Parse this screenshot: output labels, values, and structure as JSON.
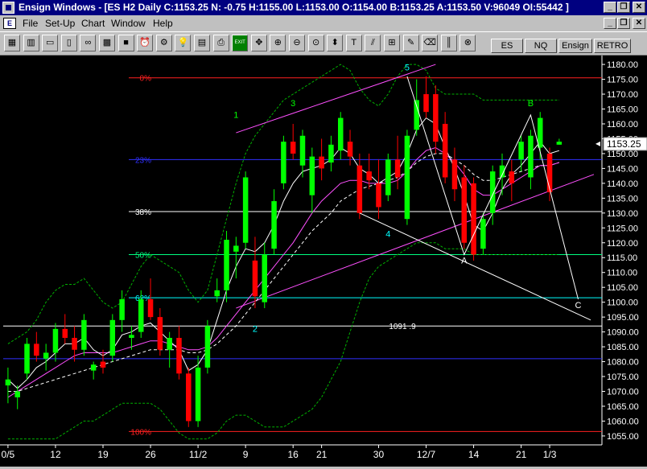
{
  "window": {
    "title": "Ensign Windows - [ES H2 Daily C:1153.25 N: -0.75 H:1155.00 L:1153.00 O:1154.00 B:1153.25 A:1153.50 V:96049 OI:55442 ]",
    "min_glyph": "_",
    "restore_glyph": "❐",
    "close_glyph": "✕"
  },
  "menu": {
    "items": [
      "File",
      "Set-Up",
      "Chart",
      "Window",
      "Help"
    ]
  },
  "toolbar": {
    "tools": [
      {
        "icon": "chart-grid-icon",
        "glyph": "▦"
      },
      {
        "icon": "chart-bars-icon",
        "glyph": "▥"
      },
      {
        "icon": "window-icon",
        "glyph": "▭"
      },
      {
        "icon": "page-icon",
        "glyph": "▯"
      },
      {
        "icon": "glasses-icon",
        "glyph": "∞"
      },
      {
        "icon": "blocks-icon",
        "glyph": "▩"
      },
      {
        "icon": "green-box-icon",
        "glyph": "■"
      },
      {
        "icon": "alarm-icon",
        "glyph": "⏰"
      },
      {
        "icon": "gear-icon",
        "glyph": "⚙"
      },
      {
        "icon": "lightbulb-icon",
        "glyph": "💡"
      },
      {
        "icon": "calculator-icon",
        "glyph": "▤"
      },
      {
        "icon": "printer-icon",
        "glyph": "⎙"
      },
      {
        "icon": "exit-icon",
        "glyph": "EXIT"
      },
      {
        "icon": "move-icon",
        "glyph": "✥"
      },
      {
        "icon": "zoom-in-icon",
        "glyph": "⊕"
      },
      {
        "icon": "zoom-out-icon",
        "glyph": "⊖"
      },
      {
        "icon": "zoom-fit-icon",
        "glyph": "⊙"
      },
      {
        "icon": "diamond-arrow-icon",
        "glyph": "⬍"
      },
      {
        "icon": "text-tool-icon",
        "glyph": "T"
      },
      {
        "icon": "fibonacci-icon",
        "glyph": "⫽"
      },
      {
        "icon": "grid-tool-icon",
        "glyph": "⊞"
      },
      {
        "icon": "pencil-icon",
        "glyph": "✎"
      },
      {
        "icon": "eraser-icon",
        "glyph": "⌫"
      },
      {
        "icon": "bars-tool-icon",
        "glyph": "║"
      },
      {
        "icon": "target-icon",
        "glyph": "⊗"
      }
    ],
    "symbol_tabs": [
      "ES",
      "NQ",
      "Ensign",
      "RETRO"
    ]
  },
  "colors": {
    "background": "#000000",
    "up_candle": "#00ff00",
    "down_candle": "#ff0000",
    "fib_0": "#ff2020",
    "fib_23": "#3030ff",
    "fib_38": "#ffffff",
    "fib_50": "#00ff80",
    "fib_62": "#00ffff",
    "bollinger": "#00b000",
    "ma_fast": "#ffffff",
    "ma_slow": "#ff50ff",
    "channel": "#ff50ff",
    "axis_text": "#ffffff"
  },
  "chart_data": {
    "type": "candlestick",
    "symbol": "ES H2",
    "timeframe": "Daily",
    "last_price_label": "1153.25",
    "last_price": 1153.25,
    "ylim": [
      1052,
      1183
    ],
    "y_ticks": [
      1055,
      1060,
      1065,
      1070,
      1075,
      1080,
      1085,
      1090,
      1095,
      1100,
      1105,
      1110,
      1115,
      1120,
      1125,
      1130,
      1135,
      1140,
      1145,
      1150,
      1155,
      1160,
      1165,
      1170,
      1175,
      1180
    ],
    "y_tick_labels": [
      "1055.00",
      "1060.00",
      "1065.00",
      "1070.00",
      "1075.00",
      "1080.00",
      "1085.00",
      "1090.00",
      "1095.00",
      "1100.00",
      "1105.00",
      "1110.00",
      "1115.00",
      "1120.00",
      "1125.00",
      "1130.00",
      "1135.00",
      "1140.00",
      "1145.00",
      "1150.00",
      "1155.00",
      "1160.00",
      "1165.00",
      "1170.00",
      "1175.00",
      "1180.00"
    ],
    "x_ticks": [
      {
        "label": "0/5",
        "i": 0
      },
      {
        "label": "12",
        "i": 5
      },
      {
        "label": "19",
        "i": 10
      },
      {
        "label": "26",
        "i": 15
      },
      {
        "label": "11/2",
        "i": 20
      },
      {
        "label": "9",
        "i": 25
      },
      {
        "label": "16",
        "i": 30
      },
      {
        "label": "21",
        "i": 33
      },
      {
        "label": "30",
        "i": 39
      },
      {
        "label": "12/7",
        "i": 44
      },
      {
        "label": "14",
        "i": 49
      },
      {
        "label": "21",
        "i": 54
      },
      {
        "label": "1/3",
        "i": 57
      }
    ],
    "fib_levels": [
      {
        "label": "0%",
        "value": 1175.5,
        "color": "#ff2020"
      },
      {
        "label": "23%",
        "value": 1148.0,
        "color": "#3030ff"
      },
      {
        "label": "38%",
        "value": 1130.5,
        "color": "#ffffff"
      },
      {
        "label": "50%",
        "value": 1116.0,
        "color": "#00ff80"
      },
      {
        "label": "62%",
        "value": 1101.5,
        "color": "#00ffff"
      },
      {
        "label": "100%",
        "value": 1056.5,
        "color": "#ff2020"
      }
    ],
    "extra_lines": [
      {
        "value": 1092.0,
        "color": "#ffffff",
        "label": "1091 .9"
      },
      {
        "value": 1081.0,
        "color": "#3030ff",
        "label": ""
      }
    ],
    "wave_labels": [
      {
        "text": "1",
        "i": 24,
        "y": 1162,
        "color": "#00ff00"
      },
      {
        "text": "2",
        "i": 26,
        "y": 1090,
        "color": "#00ffff"
      },
      {
        "text": "3",
        "i": 30,
        "y": 1166,
        "color": "#00ff00"
      },
      {
        "text": "4",
        "i": 40,
        "y": 1122,
        "color": "#00ffff"
      },
      {
        "text": "5",
        "i": 42,
        "y": 1178,
        "color": "#00ffff"
      },
      {
        "text": "A",
        "i": 48,
        "y": 1113,
        "color": "#ffffff"
      },
      {
        "text": "B",
        "i": 55,
        "y": 1166,
        "color": "#00ff00"
      },
      {
        "text": "C",
        "i": 60,
        "y": 1098,
        "color": "#ffffff"
      }
    ],
    "candles": [
      {
        "o": 1072,
        "h": 1078,
        "l": 1066,
        "c": 1074
      },
      {
        "o": 1068,
        "h": 1072,
        "l": 1064,
        "c": 1070
      },
      {
        "o": 1076,
        "h": 1088,
        "l": 1074,
        "c": 1086
      },
      {
        "o": 1086,
        "h": 1090,
        "l": 1080,
        "c": 1082
      },
      {
        "o": 1081,
        "h": 1086,
        "l": 1077,
        "c": 1083
      },
      {
        "o": 1083,
        "h": 1093,
        "l": 1080,
        "c": 1091
      },
      {
        "o": 1091,
        "h": 1096,
        "l": 1086,
        "c": 1088
      },
      {
        "o": 1088,
        "h": 1092,
        "l": 1080,
        "c": 1084
      },
      {
        "o": 1084,
        "h": 1096,
        "l": 1082,
        "c": 1094
      },
      {
        "o": 1077,
        "h": 1080,
        "l": 1074,
        "c": 1079
      },
      {
        "o": 1080,
        "h": 1084,
        "l": 1076,
        "c": 1078
      },
      {
        "o": 1082,
        "h": 1096,
        "l": 1080,
        "c": 1094
      },
      {
        "o": 1094,
        "h": 1104,
        "l": 1090,
        "c": 1101
      },
      {
        "o": 1088,
        "h": 1092,
        "l": 1084,
        "c": 1089
      },
      {
        "o": 1090,
        "h": 1104,
        "l": 1088,
        "c": 1101
      },
      {
        "o": 1101,
        "h": 1108,
        "l": 1094,
        "c": 1095
      },
      {
        "o": 1095,
        "h": 1098,
        "l": 1082,
        "c": 1084
      },
      {
        "o": 1084,
        "h": 1090,
        "l": 1078,
        "c": 1088
      },
      {
        "o": 1088,
        "h": 1092,
        "l": 1074,
        "c": 1076
      },
      {
        "o": 1076,
        "h": 1078,
        "l": 1058,
        "c": 1060
      },
      {
        "o": 1060,
        "h": 1082,
        "l": 1058,
        "c": 1078
      },
      {
        "o": 1078,
        "h": 1094,
        "l": 1076,
        "c": 1092
      },
      {
        "o": 1102,
        "h": 1108,
        "l": 1100,
        "c": 1104
      },
      {
        "o": 1104,
        "h": 1124,
        "l": 1100,
        "c": 1121
      },
      {
        "o": 1117,
        "h": 1122,
        "l": 1108,
        "c": 1119
      },
      {
        "o": 1120,
        "h": 1144,
        "l": 1118,
        "c": 1142
      },
      {
        "o": 1114,
        "h": 1122,
        "l": 1098,
        "c": 1102
      },
      {
        "o": 1100,
        "h": 1120,
        "l": 1098,
        "c": 1116
      },
      {
        "o": 1118,
        "h": 1138,
        "l": 1116,
        "c": 1134
      },
      {
        "o": 1140,
        "h": 1156,
        "l": 1138,
        "c": 1154
      },
      {
        "o": 1154,
        "h": 1160,
        "l": 1148,
        "c": 1150
      },
      {
        "o": 1146,
        "h": 1158,
        "l": 1142,
        "c": 1156
      },
      {
        "o": 1136,
        "h": 1152,
        "l": 1130,
        "c": 1149
      },
      {
        "o": 1149,
        "h": 1155,
        "l": 1141,
        "c": 1145
      },
      {
        "o": 1147,
        "h": 1156,
        "l": 1144,
        "c": 1153
      },
      {
        "o": 1151,
        "h": 1164,
        "l": 1148,
        "c": 1162
      },
      {
        "o": 1154,
        "h": 1158,
        "l": 1146,
        "c": 1149
      },
      {
        "o": 1146,
        "h": 1150,
        "l": 1128,
        "c": 1130
      },
      {
        "o": 1144,
        "h": 1150,
        "l": 1138,
        "c": 1141
      },
      {
        "o": 1140,
        "h": 1148,
        "l": 1128,
        "c": 1132
      },
      {
        "o": 1136,
        "h": 1150,
        "l": 1134,
        "c": 1148
      },
      {
        "o": 1148,
        "h": 1156,
        "l": 1138,
        "c": 1142
      },
      {
        "o": 1128,
        "h": 1158,
        "l": 1126,
        "c": 1156
      },
      {
        "o": 1158,
        "h": 1175,
        "l": 1156,
        "c": 1168
      },
      {
        "o": 1170,
        "h": 1176,
        "l": 1162,
        "c": 1164
      },
      {
        "o": 1170,
        "h": 1173,
        "l": 1150,
        "c": 1154
      },
      {
        "o": 1160,
        "h": 1164,
        "l": 1140,
        "c": 1142
      },
      {
        "o": 1148,
        "h": 1152,
        "l": 1134,
        "c": 1138
      },
      {
        "o": 1142,
        "h": 1146,
        "l": 1118,
        "c": 1120
      },
      {
        "o": 1140,
        "h": 1142,
        "l": 1114,
        "c": 1116
      },
      {
        "o": 1118,
        "h": 1130,
        "l": 1116,
        "c": 1128
      },
      {
        "o": 1130,
        "h": 1146,
        "l": 1126,
        "c": 1144
      },
      {
        "o": 1142,
        "h": 1150,
        "l": 1136,
        "c": 1146
      },
      {
        "o": 1144,
        "h": 1148,
        "l": 1134,
        "c": 1140
      },
      {
        "o": 1148,
        "h": 1156,
        "l": 1144,
        "c": 1154
      },
      {
        "o": 1142,
        "h": 1158,
        "l": 1138,
        "c": 1156
      },
      {
        "o": 1152,
        "h": 1164,
        "l": 1148,
        "c": 1162
      },
      {
        "o": 1150,
        "h": 1152,
        "l": 1134,
        "c": 1137
      },
      {
        "o": 1153,
        "h": 1155,
        "l": 1153,
        "c": 1154
      }
    ],
    "ma_fast": [
      1074,
      1071,
      1074,
      1078,
      1080,
      1083,
      1086,
      1086,
      1088,
      1084,
      1082,
      1084,
      1089,
      1090,
      1092,
      1093,
      1090,
      1087,
      1084,
      1077,
      1079,
      1084,
      1094,
      1104,
      1112,
      1118,
      1117,
      1120,
      1126,
      1134,
      1140,
      1144,
      1145,
      1146,
      1148,
      1152,
      1150,
      1145,
      1143,
      1140,
      1142,
      1144,
      1150,
      1158,
      1162,
      1160,
      1152,
      1145,
      1136,
      1126,
      1124,
      1130,
      1138,
      1143,
      1146,
      1150,
      1154,
      1150,
      1151
    ],
    "ma_slow": [
      1068,
      1070,
      1072,
      1074,
      1076,
      1078,
      1080,
      1082,
      1083,
      1083,
      1083,
      1083,
      1084,
      1085,
      1086,
      1087,
      1087,
      1086,
      1085,
      1084,
      1084,
      1085,
      1088,
      1092,
      1096,
      1100,
      1104,
      1108,
      1112,
      1116,
      1120,
      1125,
      1130,
      1134,
      1137,
      1140,
      1141,
      1141,
      1140,
      1140,
      1140,
      1141,
      1144,
      1148,
      1151,
      1152,
      1150,
      1147,
      1143,
      1138,
      1136,
      1136,
      1138,
      1140,
      1142,
      1144,
      1146,
      1146,
      1147
    ],
    "ma_dashed": [
      1070,
      1070,
      1071,
      1072,
      1073,
      1074,
      1075,
      1076,
      1077,
      1078,
      1079,
      1080,
      1081,
      1082,
      1083,
      1084,
      1084,
      1084,
      1084,
      1083,
      1083,
      1084,
      1086,
      1089,
      1092,
      1096,
      1100,
      1104,
      1108,
      1112,
      1116,
      1120,
      1124,
      1127,
      1130,
      1134,
      1136,
      1138,
      1139,
      1140,
      1141,
      1142,
      1144,
      1147,
      1149,
      1150,
      1150,
      1148,
      1146,
      1143,
      1141,
      1141,
      1142,
      1143,
      1144,
      1145,
      1146,
      1146,
      1147
    ],
    "bb_upper": [
      1086,
      1088,
      1090,
      1094,
      1100,
      1104,
      1106,
      1106,
      1108,
      1104,
      1100,
      1098,
      1100,
      1106,
      1112,
      1116,
      1114,
      1112,
      1110,
      1104,
      1100,
      1104,
      1116,
      1128,
      1140,
      1150,
      1156,
      1160,
      1164,
      1168,
      1170,
      1172,
      1174,
      1176,
      1178,
      1180,
      1178,
      1172,
      1168,
      1166,
      1170,
      1176,
      1180,
      1180,
      1178,
      1172,
      1170,
      1170,
      1170,
      1170,
      1168,
      1168,
      1168,
      1168,
      1168,
      1168,
      1168,
      1168,
      1168
    ],
    "bb_lower": [
      1054,
      1054,
      1054,
      1054,
      1054,
      1054,
      1056,
      1058,
      1060,
      1060,
      1062,
      1064,
      1066,
      1066,
      1066,
      1066,
      1064,
      1060,
      1056,
      1054,
      1054,
      1054,
      1056,
      1060,
      1062,
      1062,
      1060,
      1058,
      1058,
      1058,
      1060,
      1062,
      1064,
      1068,
      1074,
      1080,
      1090,
      1100,
      1108,
      1112,
      1114,
      1116,
      1118,
      1120,
      1120,
      1120,
      1118,
      1118,
      1118,
      1116,
      1116,
      1116,
      1116,
      1116,
      1116,
      1116,
      1116,
      1116,
      1116
    ]
  }
}
